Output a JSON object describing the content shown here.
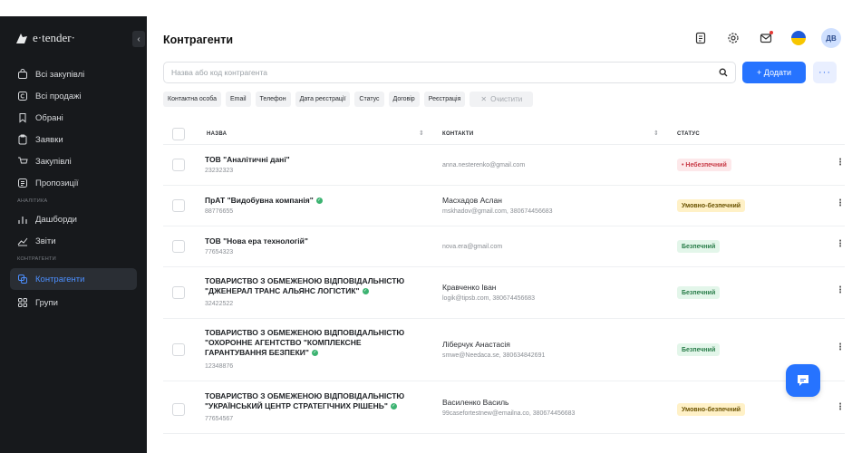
{
  "logo": {
    "text": "e·tender·"
  },
  "sidebar": {
    "items_top": [
      {
        "label": "Всі закупівлі",
        "icon": "bag-icon"
      },
      {
        "label": "Всі продажі",
        "icon": "sales-icon"
      },
      {
        "label": "Обрані",
        "icon": "bookmark-icon"
      },
      {
        "label": "Заявки",
        "icon": "clipboard-icon"
      },
      {
        "label": "Закупівлі",
        "icon": "cart-icon"
      },
      {
        "label": "Пропозиції",
        "icon": "list-icon"
      }
    ],
    "section_analytics": "АНАЛІТИКА",
    "items_analytics": [
      {
        "label": "Дашборди",
        "icon": "bars-icon"
      },
      {
        "label": "Звіти",
        "icon": "line-chart-icon"
      }
    ],
    "section_contractors": "КОНТРАГЕНТИ",
    "items_contractors": [
      {
        "label": "Контрагенти",
        "icon": "contractors-icon",
        "active": true
      },
      {
        "label": "Групи",
        "icon": "grid-icon"
      }
    ]
  },
  "header": {
    "title": "Контрагенти",
    "avatar_initials": "ДВ"
  },
  "search": {
    "placeholder": "Назва або код контрагента",
    "value": ""
  },
  "actions": {
    "add_label": "+ Додати",
    "more_label": "···"
  },
  "filters": [
    "Контактна особа",
    "Email",
    "Телефон",
    "Дата реєстрації",
    "Статус",
    "Договір",
    "Реєстрація"
  ],
  "clear_label": "Очистити",
  "table": {
    "columns": [
      "НАЗВА",
      "КОНТАКТИ",
      "СТАТУС"
    ],
    "rows": [
      {
        "name": "ТОВ \"Аналітичні дані\"",
        "code": "23232323",
        "contact_name": "",
        "contact_info": "anna.nesterenko@gmail.com",
        "status": "• Небезпечний",
        "verified": false
      },
      {
        "name": "ПрАТ \"Видобувна компанія\"",
        "code": "88776655",
        "contact_name": "Масхадов Аслан",
        "contact_info": "mskhadov@gmail.com, 380674456683",
        "status": "Умовно-безпечний",
        "verified": true
      },
      {
        "name": "ТОВ \"Нова ера технологій\"",
        "code": "77654323",
        "contact_name": "",
        "contact_info": "nova.era@gmail.com",
        "status": "Безпечний",
        "verified": false
      },
      {
        "name_line1": "ТОВАРИСТВО З ОБМЕЖЕНОЮ ВІДПОВІДАЛЬНІСТЮ",
        "name_line2": "\"ДЖЕНЕРАЛ ТРАНС АЛЬЯНС ЛОГІСТИК\"",
        "code": "32422522",
        "contact_name": "Кравченко Іван",
        "contact_info": "logik@tipsb.com, 380674456683",
        "status": "Безпечний",
        "verified": true
      },
      {
        "name_line1": "ТОВАРИСТВО З ОБМЕЖЕНОЮ ВІДПОВІДАЛЬНІСТЮ",
        "name_line2": "\"ОХОРОННЕ АГЕНТСТВО \"КОМПЛЕКСНЕ",
        "name_line3": "ГАРАНТУВАННЯ БЕЗПЕКИ\"",
        "code": "12348876",
        "contact_name": "Ліберчук Анастасія",
        "contact_info": "smwe@Needaca.se, 380634842691",
        "status": "Безпечний",
        "verified": true
      },
      {
        "name_line1": "ТОВАРИСТВО З ОБМЕЖЕНОЮ ВІДПОВІДАЛЬНІСТЮ",
        "name_line2": "\"УКРАЇНСЬКИЙ ЦЕНТР СТРАТЕГІЧНИХ РІШЕНЬ\"",
        "code": "77654567",
        "contact_name": "Василенко Василь",
        "contact_info": "99casefortestnew@emailna.co, 380674456683",
        "status": "Умовно-безпечний",
        "verified": true
      }
    ]
  },
  "colors": {
    "accent": "#2673ff",
    "sidebar_bg": "#17191c",
    "danger": "#c83a46",
    "warning_bg": "#fff1c7",
    "safe_bg": "#e3f6ea"
  }
}
